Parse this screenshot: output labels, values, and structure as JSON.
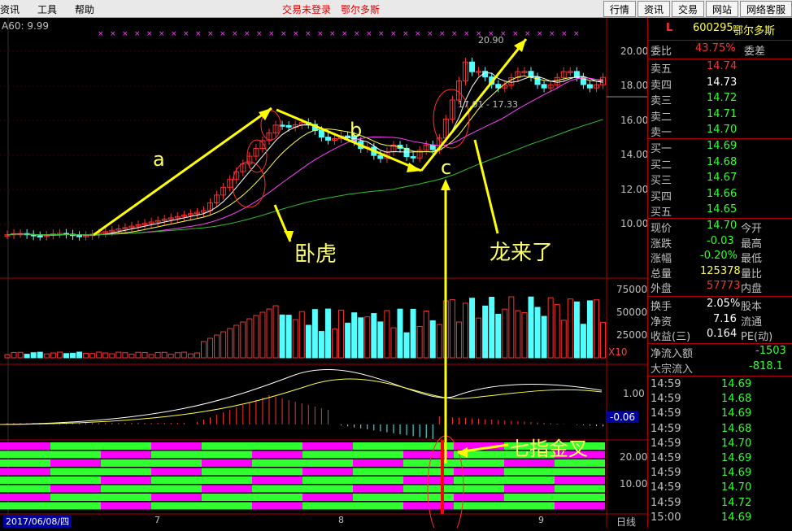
{
  "menubar": {
    "left": [
      "资讯",
      "工具",
      "帮助"
    ],
    "status": "交易未登录　鄂尔多斯",
    "buttons": [
      "行情",
      "资讯",
      "交易",
      "网站",
      "网络客服"
    ]
  },
  "indicator": {
    "ma_label": "A60: 9.99"
  },
  "price_axis": [
    "20.00",
    "18.00",
    "16.00",
    "14.00",
    "12.00",
    "10.00"
  ],
  "volume_axis": [
    "75000",
    "50000",
    "25000"
  ],
  "volume_unit": "X10",
  "macd_axis": [
    "1.00"
  ],
  "macd_value": "-0.06",
  "kdj_axis": [
    "20.00",
    "10.00"
  ],
  "peak_label": "20.90",
  "range_label": "17.01 - 17.33",
  "date_axis": {
    "start": "2017/06/08/四",
    "months": [
      "7",
      "8",
      "9"
    ],
    "period": "日线"
  },
  "annotations": {
    "a": "a",
    "b": "b",
    "c": "c",
    "wohu": "卧虎",
    "longlaile": "龙来了",
    "qizhi": "七指金叉"
  },
  "quote": {
    "code": "600295",
    "name": "鄂尔多斯",
    "flag": "L",
    "weibi_label": "委比",
    "weibi": "43.75%",
    "weicha_label": "委差",
    "asks": [
      {
        "label": "卖五",
        "price": "14.74"
      },
      {
        "label": "卖四",
        "price": "14.73"
      },
      {
        "label": "卖三",
        "price": "14.72"
      },
      {
        "label": "卖二",
        "price": "14.71"
      },
      {
        "label": "卖一",
        "price": "14.70"
      }
    ],
    "bids": [
      {
        "label": "买一",
        "price": "14.69"
      },
      {
        "label": "买二",
        "price": "14.68"
      },
      {
        "label": "买三",
        "price": "14.67"
      },
      {
        "label": "买四",
        "price": "14.66"
      },
      {
        "label": "买五",
        "price": "14.65"
      }
    ],
    "stats": [
      {
        "l1": "现价",
        "v": "14.70",
        "l2": "今开"
      },
      {
        "l1": "涨跌",
        "v": "-0.03",
        "l2": "最高"
      },
      {
        "l1": "涨幅",
        "v": "-0.20%",
        "l2": "最低"
      },
      {
        "l1": "总量",
        "v": "125378",
        "l2": "量比"
      },
      {
        "l1": "外盘",
        "v": "57773",
        "l2": "内盘"
      }
    ],
    "stats2": [
      {
        "l1": "换手",
        "v": "2.05%",
        "l2": "股本"
      },
      {
        "l1": "净资",
        "v": "7.16",
        "l2": "流通"
      },
      {
        "l1": "收益(三)",
        "v": "0.164",
        "l2": "PE(动)"
      }
    ],
    "flow": [
      {
        "l": "净流入额",
        "v": "-1503"
      },
      {
        "l": "大宗流入",
        "v": "-818.1"
      }
    ],
    "ticks": [
      {
        "t": "14:59",
        "p": "14.69"
      },
      {
        "t": "14:59",
        "p": "14.68"
      },
      {
        "t": "14:59",
        "p": "14.69"
      },
      {
        "t": "14:59",
        "p": "14.68"
      },
      {
        "t": "14:59",
        "p": "14.70"
      },
      {
        "t": "14:59",
        "p": "14.69"
      },
      {
        "t": "14:59",
        "p": "14.69"
      },
      {
        "t": "14:59",
        "p": "14.70"
      },
      {
        "t": "14:59",
        "p": "14.72"
      },
      {
        "t": "15:00",
        "p": "14.69"
      }
    ]
  }
}
